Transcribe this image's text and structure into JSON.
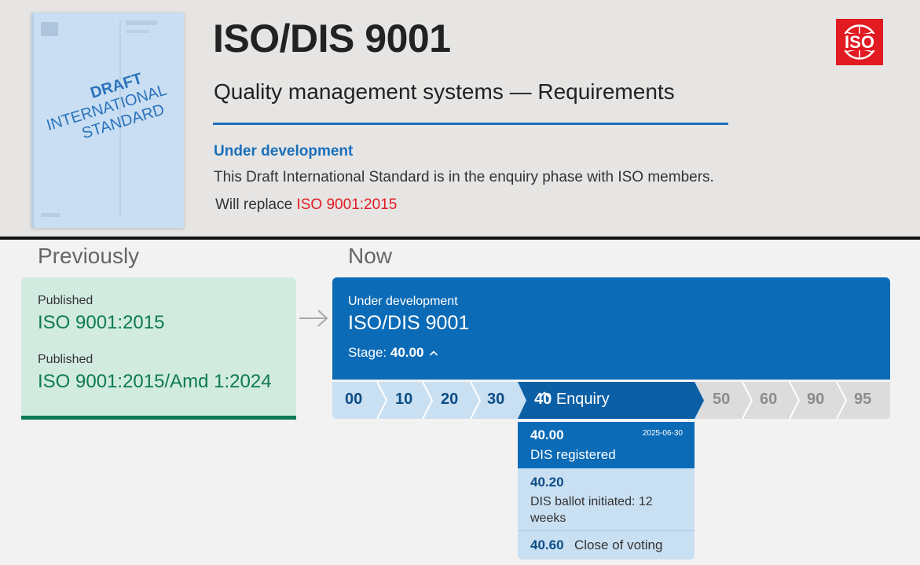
{
  "header": {
    "cover": {
      "stamp_line1": "DRAFT",
      "stamp_line2": "INTERNATIONAL",
      "stamp_line3": "STANDARD"
    },
    "title": "ISO/DIS 9001",
    "subtitle": "Quality management systems — Requirements",
    "status": "Under development",
    "description": "This Draft International Standard is in the enquiry phase with ISO members.",
    "replace_prefix": "Will replace",
    "replace_link": "ISO 9001:2015",
    "logo_text": "ISO"
  },
  "previously": {
    "heading": "Previously",
    "items": [
      {
        "label": "Published",
        "value": "ISO 9001:2015"
      },
      {
        "label": "Published",
        "value": "ISO 9001:2015/Amd 1:2024"
      }
    ]
  },
  "now": {
    "heading": "Now",
    "label": "Under development",
    "value": "ISO/DIS 9001",
    "stage_prefix": "Stage:",
    "stage_value": "40.00",
    "stages": [
      "00",
      "10",
      "20",
      "30",
      "40",
      "50",
      "60",
      "90",
      "95"
    ],
    "active_stage_code": "40",
    "active_stage_name": "Enquiry",
    "substages": [
      {
        "code": "40.00",
        "date": "2025-06-30",
        "desc": "DIS registered"
      },
      {
        "code": "40.20",
        "desc": "DIS ballot initiated: 12 weeks"
      },
      {
        "code": "40.60",
        "desc": "Close of voting"
      }
    ]
  },
  "colors": {
    "accent_blue": "#0b6bb6",
    "published_green": "#0d7a53",
    "iso_red": "#e21a22"
  }
}
